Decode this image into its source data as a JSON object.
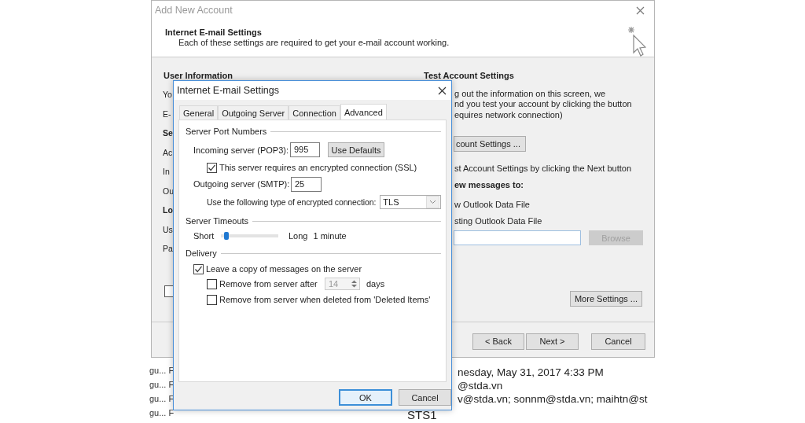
{
  "account_window": {
    "title": "Add New Account",
    "header_title": "Internet E-mail Settings",
    "header_subtitle": "Each of these settings are required to get your e-mail account working.",
    "left_heading": "User Information",
    "left_labels": [
      {
        "text": "Yo",
        "kind": "label"
      },
      {
        "text": "E-",
        "kind": "label"
      },
      {
        "text": "Se",
        "kind": "heading"
      },
      {
        "text": "Ac",
        "kind": "label"
      },
      {
        "text": "In",
        "kind": "label"
      },
      {
        "text": "Ou",
        "kind": "label"
      },
      {
        "text": "Lo",
        "kind": "heading"
      },
      {
        "text": "Us",
        "kind": "label"
      },
      {
        "text": "Pa",
        "kind": "label"
      }
    ],
    "remember_checkbox": {
      "checked": false
    },
    "right_heading": "Test Account Settings",
    "test_description": [
      "g out the information on this screen, we",
      "nd you test your account by clicking the button",
      "equires network connection)"
    ],
    "test_button": "count Settings ...",
    "next_hint": "st Account Settings by clicking the Next button",
    "deliver_heading": "ew messages to:",
    "deliver_options": [
      "w Outlook Data File",
      "sting Outlook Data File"
    ],
    "browse_button": {
      "label": "Browse",
      "disabled": true
    },
    "more_settings_button": "More Settings ...",
    "footer_buttons": [
      "< Back",
      "Next >",
      "Cancel"
    ]
  },
  "settings_dialog": {
    "title": "Internet E-mail Settings",
    "tabs": [
      {
        "label": "General",
        "selected": false
      },
      {
        "label": "Outgoing Server",
        "selected": false
      },
      {
        "label": "Connection",
        "selected": false
      },
      {
        "label": "Advanced",
        "selected": true
      }
    ],
    "port_group": "Server Port Numbers",
    "incoming_label": "Incoming server (POP3):",
    "incoming_value": "995",
    "use_defaults_button": "Use Defaults",
    "ssl": {
      "label": "This server requires an encrypted connection (SSL)",
      "checked": true
    },
    "outgoing_label": "Outgoing server (SMTP):",
    "outgoing_value": "25",
    "encryption_label": "Use the following type of encrypted connection:",
    "encryption_value": "TLS",
    "timeouts_group": "Server Timeouts",
    "timeout": {
      "min_label": "Short",
      "max_label": "Long",
      "level": 0.1,
      "reading": "1 minute"
    },
    "delivery_group": "Delivery",
    "leave_copy": {
      "label": "Leave a copy of messages on the server",
      "checked": true
    },
    "remove_after": {
      "label": "Remove from server after",
      "checked": false,
      "days": "14",
      "unit": "days"
    },
    "remove_deleted": {
      "label": "Remove from server when deleted from 'Deleted Items'",
      "checked": false
    },
    "buttons": [
      {
        "label": "OK",
        "default": true
      },
      {
        "label": "Cancel",
        "default": false
      }
    ]
  },
  "background": {
    "message_list": [
      "gu... F",
      "gu... F",
      "gu... F",
      "gu... F"
    ],
    "message_header": [
      "nesday, May 31, 2017 4:33 PM",
      "@stda.vn",
      "v@stda.vn; sonnm@stda.vn; maihtn@st"
    ],
    "subject_fragment": "STS1"
  }
}
